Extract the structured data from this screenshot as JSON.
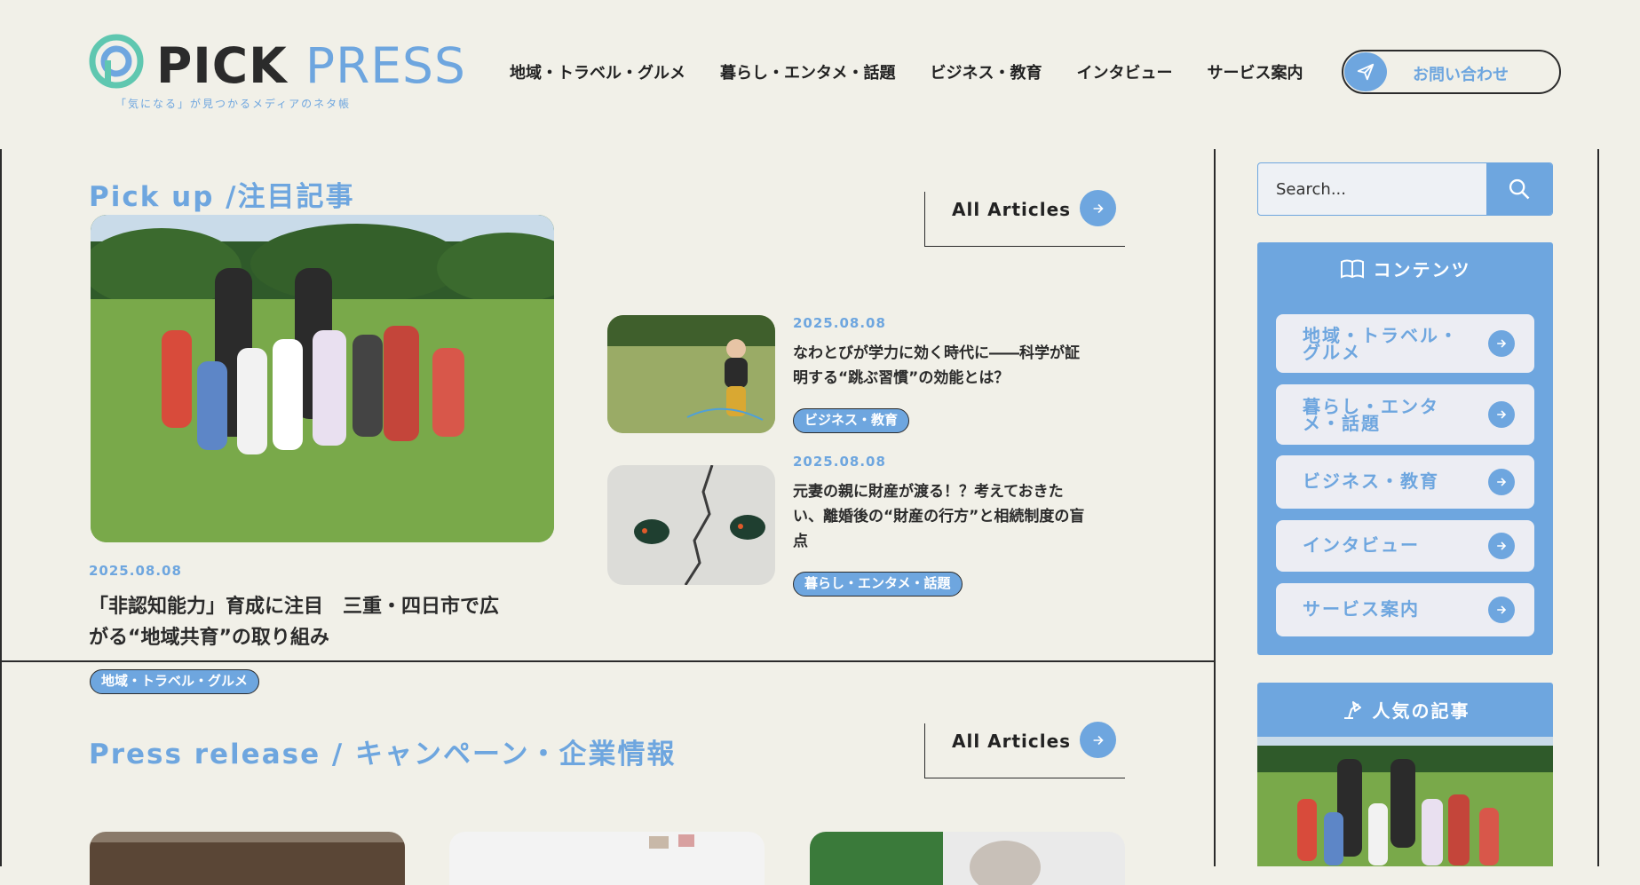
{
  "header": {
    "logo_pick": "PICK",
    "logo_press": "PRESS",
    "tagline": "「気になる」が見つかるメディアのネタ帳",
    "nav": [
      "地域・トラベル・グルメ",
      "暮らし・エンタメ・話題",
      "ビジネス・教育",
      "インタビュー",
      "サービス案内"
    ],
    "contact_label": "お問い合わせ"
  },
  "pickup": {
    "title": "Pick up /注目記事",
    "all_articles": "All Articles",
    "main": {
      "date": "2025.08.08",
      "title_line1": "「非認知能力」育成に注目　三重・四日市で広",
      "title_line2": "がる“地域共育”の取り組み",
      "tag": "地域・トラベル・グルメ"
    },
    "side": [
      {
        "date": "2025.08.08",
        "title_line1": "なわとびが学力に効く時代に――科学が証",
        "title_line2": "明する“跳ぶ習慣”の効能とは？",
        "title_line3": "",
        "tag": "ビジネス・教育"
      },
      {
        "date": "2025.08.08",
        "title_line1": "元妻の親に財産が渡る！？考えておきた",
        "title_line2": "い、離婚後の“財産の行方”と相続制度の盲",
        "title_line3": "点",
        "tag": "暮らし・エンタメ・話題"
      }
    ]
  },
  "press": {
    "title": "Press release / キャンペーン・企業情報",
    "all_articles": "All Articles"
  },
  "sidebar": {
    "search_placeholder": "Search...",
    "contents_title": "コンテンツ",
    "contents": [
      {
        "line1": "地域・トラベル・",
        "line2": "グルメ"
      },
      {
        "line1": "暮らし・エンタ",
        "line2": "メ・話題"
      },
      {
        "line1": "ビジネス・教育",
        "line2": ""
      },
      {
        "line1": "インタビュー",
        "line2": ""
      },
      {
        "line1": "サービス案内",
        "line2": ""
      }
    ],
    "popular_title": "人気の記事"
  },
  "colors": {
    "background": "#f1f0e8",
    "accent": "#6ea6df",
    "text": "#2b2b2b"
  },
  "icons": [
    "logo-mark-icon",
    "paper-plane-icon",
    "arrow-right-icon",
    "search-icon",
    "book-icon",
    "lamp-icon"
  ]
}
